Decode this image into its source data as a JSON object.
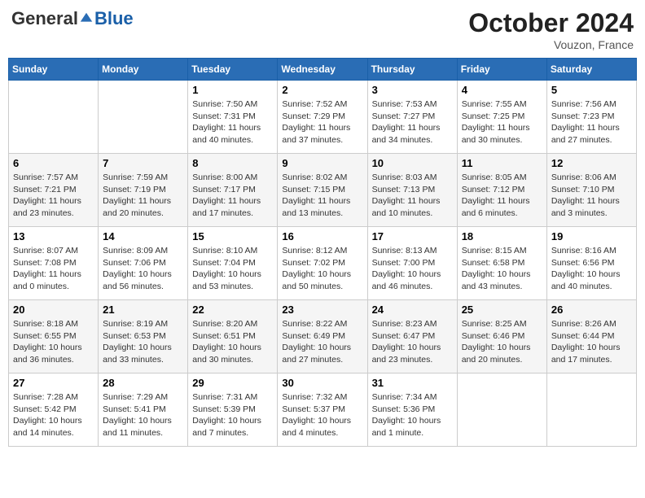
{
  "header": {
    "logo": {
      "part1": "General",
      "part2": "Blue"
    },
    "month": "October 2024",
    "location": "Vouzon, France"
  },
  "weekdays": [
    "Sunday",
    "Monday",
    "Tuesday",
    "Wednesday",
    "Thursday",
    "Friday",
    "Saturday"
  ],
  "weeks": [
    [
      null,
      null,
      {
        "day": 1,
        "sunrise": "7:50 AM",
        "sunset": "7:31 PM",
        "daylight": "11 hours and 40 minutes."
      },
      {
        "day": 2,
        "sunrise": "7:52 AM",
        "sunset": "7:29 PM",
        "daylight": "11 hours and 37 minutes."
      },
      {
        "day": 3,
        "sunrise": "7:53 AM",
        "sunset": "7:27 PM",
        "daylight": "11 hours and 34 minutes."
      },
      {
        "day": 4,
        "sunrise": "7:55 AM",
        "sunset": "7:25 PM",
        "daylight": "11 hours and 30 minutes."
      },
      {
        "day": 5,
        "sunrise": "7:56 AM",
        "sunset": "7:23 PM",
        "daylight": "11 hours and 27 minutes."
      }
    ],
    [
      {
        "day": 6,
        "sunrise": "7:57 AM",
        "sunset": "7:21 PM",
        "daylight": "11 hours and 23 minutes."
      },
      {
        "day": 7,
        "sunrise": "7:59 AM",
        "sunset": "7:19 PM",
        "daylight": "11 hours and 20 minutes."
      },
      {
        "day": 8,
        "sunrise": "8:00 AM",
        "sunset": "7:17 PM",
        "daylight": "11 hours and 17 minutes."
      },
      {
        "day": 9,
        "sunrise": "8:02 AM",
        "sunset": "7:15 PM",
        "daylight": "11 hours and 13 minutes."
      },
      {
        "day": 10,
        "sunrise": "8:03 AM",
        "sunset": "7:13 PM",
        "daylight": "11 hours and 10 minutes."
      },
      {
        "day": 11,
        "sunrise": "8:05 AM",
        "sunset": "7:12 PM",
        "daylight": "11 hours and 6 minutes."
      },
      {
        "day": 12,
        "sunrise": "8:06 AM",
        "sunset": "7:10 PM",
        "daylight": "11 hours and 3 minutes."
      }
    ],
    [
      {
        "day": 13,
        "sunrise": "8:07 AM",
        "sunset": "7:08 PM",
        "daylight": "11 hours and 0 minutes."
      },
      {
        "day": 14,
        "sunrise": "8:09 AM",
        "sunset": "7:06 PM",
        "daylight": "10 hours and 56 minutes."
      },
      {
        "day": 15,
        "sunrise": "8:10 AM",
        "sunset": "7:04 PM",
        "daylight": "10 hours and 53 minutes."
      },
      {
        "day": 16,
        "sunrise": "8:12 AM",
        "sunset": "7:02 PM",
        "daylight": "10 hours and 50 minutes."
      },
      {
        "day": 17,
        "sunrise": "8:13 AM",
        "sunset": "7:00 PM",
        "daylight": "10 hours and 46 minutes."
      },
      {
        "day": 18,
        "sunrise": "8:15 AM",
        "sunset": "6:58 PM",
        "daylight": "10 hours and 43 minutes."
      },
      {
        "day": 19,
        "sunrise": "8:16 AM",
        "sunset": "6:56 PM",
        "daylight": "10 hours and 40 minutes."
      }
    ],
    [
      {
        "day": 20,
        "sunrise": "8:18 AM",
        "sunset": "6:55 PM",
        "daylight": "10 hours and 36 minutes."
      },
      {
        "day": 21,
        "sunrise": "8:19 AM",
        "sunset": "6:53 PM",
        "daylight": "10 hours and 33 minutes."
      },
      {
        "day": 22,
        "sunrise": "8:20 AM",
        "sunset": "6:51 PM",
        "daylight": "10 hours and 30 minutes."
      },
      {
        "day": 23,
        "sunrise": "8:22 AM",
        "sunset": "6:49 PM",
        "daylight": "10 hours and 27 minutes."
      },
      {
        "day": 24,
        "sunrise": "8:23 AM",
        "sunset": "6:47 PM",
        "daylight": "10 hours and 23 minutes."
      },
      {
        "day": 25,
        "sunrise": "8:25 AM",
        "sunset": "6:46 PM",
        "daylight": "10 hours and 20 minutes."
      },
      {
        "day": 26,
        "sunrise": "8:26 AM",
        "sunset": "6:44 PM",
        "daylight": "10 hours and 17 minutes."
      }
    ],
    [
      {
        "day": 27,
        "sunrise": "7:28 AM",
        "sunset": "5:42 PM",
        "daylight": "10 hours and 14 minutes."
      },
      {
        "day": 28,
        "sunrise": "7:29 AM",
        "sunset": "5:41 PM",
        "daylight": "10 hours and 11 minutes."
      },
      {
        "day": 29,
        "sunrise": "7:31 AM",
        "sunset": "5:39 PM",
        "daylight": "10 hours and 7 minutes."
      },
      {
        "day": 30,
        "sunrise": "7:32 AM",
        "sunset": "5:37 PM",
        "daylight": "10 hours and 4 minutes."
      },
      {
        "day": 31,
        "sunrise": "7:34 AM",
        "sunset": "5:36 PM",
        "daylight": "10 hours and 1 minute."
      },
      null,
      null
    ]
  ]
}
